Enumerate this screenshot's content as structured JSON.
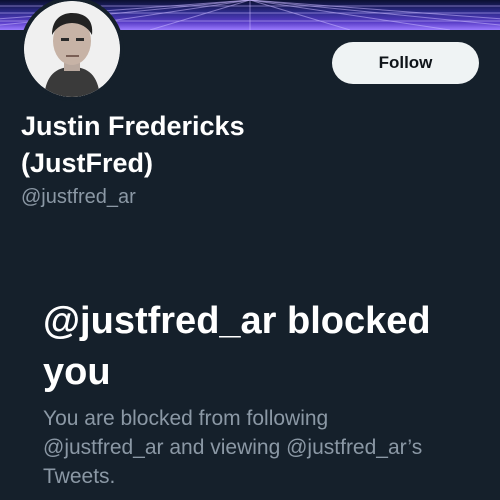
{
  "banner": {
    "colors": [
      "#0b1030",
      "#2c2a8a",
      "#5a3ec8",
      "#9b7bff"
    ]
  },
  "profile": {
    "avatar_icon": "profile-photo",
    "follow_label": "Follow",
    "display_name": "Justin Fredericks (JustFred)",
    "handle": "@justfred_ar"
  },
  "blocked": {
    "title": "@justfred_ar blocked you",
    "description": "You are blocked from following @justfred_ar and viewing @justfred_ar’s Tweets."
  },
  "colors": {
    "background": "#15202b",
    "secondary_text": "#8b98a5",
    "button_bg": "#eff3f4"
  }
}
